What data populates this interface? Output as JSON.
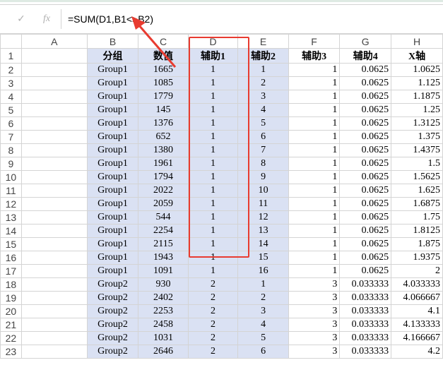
{
  "formula_bar": {
    "cancel_icon": "check-icon",
    "fx_label": "fx",
    "formula": "=SUM(D1,B1<>B2)"
  },
  "columns": [
    "A",
    "B",
    "C",
    "D",
    "E",
    "F",
    "G",
    "H"
  ],
  "header_row": {
    "row": "1",
    "B": "分组",
    "C": "数值",
    "D": "辅助1",
    "E": "辅助2",
    "F": "辅助3",
    "G": "辅助4",
    "H": "X轴"
  },
  "rows": [
    {
      "row": "2",
      "B": "Group1",
      "C": "1665",
      "D": "1",
      "E": "1",
      "F": "1",
      "G": "0.0625",
      "H": "1.0625"
    },
    {
      "row": "3",
      "B": "Group1",
      "C": "1085",
      "D": "1",
      "E": "2",
      "F": "1",
      "G": "0.0625",
      "H": "1.125"
    },
    {
      "row": "4",
      "B": "Group1",
      "C": "1779",
      "D": "1",
      "E": "3",
      "F": "1",
      "G": "0.0625",
      "H": "1.1875"
    },
    {
      "row": "5",
      "B": "Group1",
      "C": "145",
      "D": "1",
      "E": "4",
      "F": "1",
      "G": "0.0625",
      "H": "1.25"
    },
    {
      "row": "6",
      "B": "Group1",
      "C": "1376",
      "D": "1",
      "E": "5",
      "F": "1",
      "G": "0.0625",
      "H": "1.3125"
    },
    {
      "row": "7",
      "B": "Group1",
      "C": "652",
      "D": "1",
      "E": "6",
      "F": "1",
      "G": "0.0625",
      "H": "1.375"
    },
    {
      "row": "8",
      "B": "Group1",
      "C": "1380",
      "D": "1",
      "E": "7",
      "F": "1",
      "G": "0.0625",
      "H": "1.4375"
    },
    {
      "row": "9",
      "B": "Group1",
      "C": "1961",
      "D": "1",
      "E": "8",
      "F": "1",
      "G": "0.0625",
      "H": "1.5"
    },
    {
      "row": "10",
      "B": "Group1",
      "C": "1794",
      "D": "1",
      "E": "9",
      "F": "1",
      "G": "0.0625",
      "H": "1.5625"
    },
    {
      "row": "11",
      "B": "Group1",
      "C": "2022",
      "D": "1",
      "E": "10",
      "F": "1",
      "G": "0.0625",
      "H": "1.625"
    },
    {
      "row": "12",
      "B": "Group1",
      "C": "2059",
      "D": "1",
      "E": "11",
      "F": "1",
      "G": "0.0625",
      "H": "1.6875"
    },
    {
      "row": "13",
      "B": "Group1",
      "C": "544",
      "D": "1",
      "E": "12",
      "F": "1",
      "G": "0.0625",
      "H": "1.75"
    },
    {
      "row": "14",
      "B": "Group1",
      "C": "2254",
      "D": "1",
      "E": "13",
      "F": "1",
      "G": "0.0625",
      "H": "1.8125"
    },
    {
      "row": "15",
      "B": "Group1",
      "C": "2115",
      "D": "1",
      "E": "14",
      "F": "1",
      "G": "0.0625",
      "H": "1.875"
    },
    {
      "row": "16",
      "B": "Group1",
      "C": "1943",
      "D": "1",
      "E": "15",
      "F": "1",
      "G": "0.0625",
      "H": "1.9375"
    },
    {
      "row": "17",
      "B": "Group1",
      "C": "1091",
      "D": "1",
      "E": "16",
      "F": "1",
      "G": "0.0625",
      "H": "2"
    },
    {
      "row": "18",
      "B": "Group2",
      "C": "930",
      "D": "2",
      "E": "1",
      "F": "3",
      "G": "0.033333",
      "H": "4.033333"
    },
    {
      "row": "19",
      "B": "Group2",
      "C": "2402",
      "D": "2",
      "E": "2",
      "F": "3",
      "G": "0.033333",
      "H": "4.066667"
    },
    {
      "row": "20",
      "B": "Group2",
      "C": "2253",
      "D": "2",
      "E": "3",
      "F": "3",
      "G": "0.033333",
      "H": "4.1"
    },
    {
      "row": "21",
      "B": "Group2",
      "C": "2458",
      "D": "2",
      "E": "4",
      "F": "3",
      "G": "0.033333",
      "H": "4.133333"
    },
    {
      "row": "22",
      "B": "Group2",
      "C": "1031",
      "D": "2",
      "E": "5",
      "F": "3",
      "G": "0.033333",
      "H": "4.166667"
    },
    {
      "row": "23",
      "B": "Group2",
      "C": "2646",
      "D": "2",
      "E": "6",
      "F": "3",
      "G": "0.033333",
      "H": "4.2"
    }
  ],
  "colors": {
    "highlight": "#e83b30",
    "fill_blue": "#dae1f3",
    "grid": "#d4d4d4"
  }
}
